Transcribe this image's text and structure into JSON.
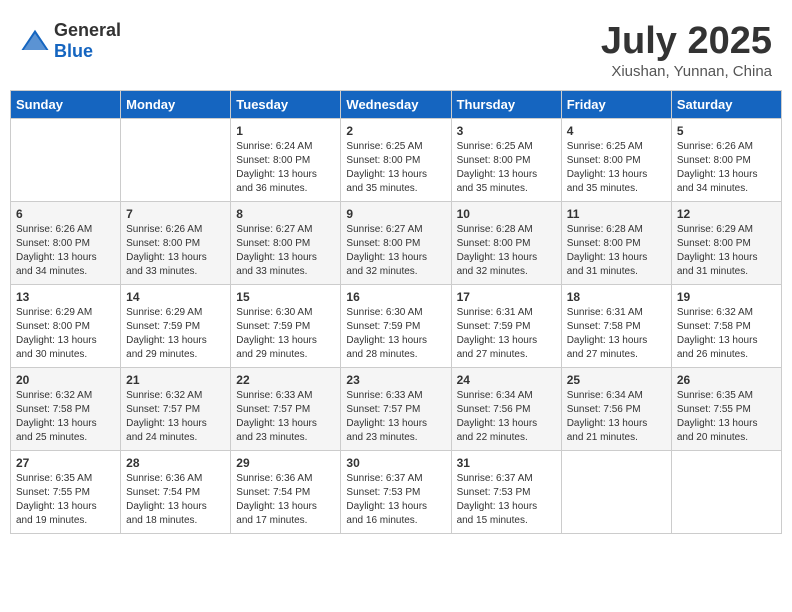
{
  "header": {
    "logo_general": "General",
    "logo_blue": "Blue",
    "month_title": "July 2025",
    "location": "Xiushan, Yunnan, China"
  },
  "weekdays": [
    "Sunday",
    "Monday",
    "Tuesday",
    "Wednesday",
    "Thursday",
    "Friday",
    "Saturday"
  ],
  "weeks": [
    [
      {
        "day": "",
        "info": ""
      },
      {
        "day": "",
        "info": ""
      },
      {
        "day": "1",
        "info": "Sunrise: 6:24 AM\nSunset: 8:00 PM\nDaylight: 13 hours and 36 minutes."
      },
      {
        "day": "2",
        "info": "Sunrise: 6:25 AM\nSunset: 8:00 PM\nDaylight: 13 hours and 35 minutes."
      },
      {
        "day": "3",
        "info": "Sunrise: 6:25 AM\nSunset: 8:00 PM\nDaylight: 13 hours and 35 minutes."
      },
      {
        "day": "4",
        "info": "Sunrise: 6:25 AM\nSunset: 8:00 PM\nDaylight: 13 hours and 35 minutes."
      },
      {
        "day": "5",
        "info": "Sunrise: 6:26 AM\nSunset: 8:00 PM\nDaylight: 13 hours and 34 minutes."
      }
    ],
    [
      {
        "day": "6",
        "info": "Sunrise: 6:26 AM\nSunset: 8:00 PM\nDaylight: 13 hours and 34 minutes."
      },
      {
        "day": "7",
        "info": "Sunrise: 6:26 AM\nSunset: 8:00 PM\nDaylight: 13 hours and 33 minutes."
      },
      {
        "day": "8",
        "info": "Sunrise: 6:27 AM\nSunset: 8:00 PM\nDaylight: 13 hours and 33 minutes."
      },
      {
        "day": "9",
        "info": "Sunrise: 6:27 AM\nSunset: 8:00 PM\nDaylight: 13 hours and 32 minutes."
      },
      {
        "day": "10",
        "info": "Sunrise: 6:28 AM\nSunset: 8:00 PM\nDaylight: 13 hours and 32 minutes."
      },
      {
        "day": "11",
        "info": "Sunrise: 6:28 AM\nSunset: 8:00 PM\nDaylight: 13 hours and 31 minutes."
      },
      {
        "day": "12",
        "info": "Sunrise: 6:29 AM\nSunset: 8:00 PM\nDaylight: 13 hours and 31 minutes."
      }
    ],
    [
      {
        "day": "13",
        "info": "Sunrise: 6:29 AM\nSunset: 8:00 PM\nDaylight: 13 hours and 30 minutes."
      },
      {
        "day": "14",
        "info": "Sunrise: 6:29 AM\nSunset: 7:59 PM\nDaylight: 13 hours and 29 minutes."
      },
      {
        "day": "15",
        "info": "Sunrise: 6:30 AM\nSunset: 7:59 PM\nDaylight: 13 hours and 29 minutes."
      },
      {
        "day": "16",
        "info": "Sunrise: 6:30 AM\nSunset: 7:59 PM\nDaylight: 13 hours and 28 minutes."
      },
      {
        "day": "17",
        "info": "Sunrise: 6:31 AM\nSunset: 7:59 PM\nDaylight: 13 hours and 27 minutes."
      },
      {
        "day": "18",
        "info": "Sunrise: 6:31 AM\nSunset: 7:58 PM\nDaylight: 13 hours and 27 minutes."
      },
      {
        "day": "19",
        "info": "Sunrise: 6:32 AM\nSunset: 7:58 PM\nDaylight: 13 hours and 26 minutes."
      }
    ],
    [
      {
        "day": "20",
        "info": "Sunrise: 6:32 AM\nSunset: 7:58 PM\nDaylight: 13 hours and 25 minutes."
      },
      {
        "day": "21",
        "info": "Sunrise: 6:32 AM\nSunset: 7:57 PM\nDaylight: 13 hours and 24 minutes."
      },
      {
        "day": "22",
        "info": "Sunrise: 6:33 AM\nSunset: 7:57 PM\nDaylight: 13 hours and 23 minutes."
      },
      {
        "day": "23",
        "info": "Sunrise: 6:33 AM\nSunset: 7:57 PM\nDaylight: 13 hours and 23 minutes."
      },
      {
        "day": "24",
        "info": "Sunrise: 6:34 AM\nSunset: 7:56 PM\nDaylight: 13 hours and 22 minutes."
      },
      {
        "day": "25",
        "info": "Sunrise: 6:34 AM\nSunset: 7:56 PM\nDaylight: 13 hours and 21 minutes."
      },
      {
        "day": "26",
        "info": "Sunrise: 6:35 AM\nSunset: 7:55 PM\nDaylight: 13 hours and 20 minutes."
      }
    ],
    [
      {
        "day": "27",
        "info": "Sunrise: 6:35 AM\nSunset: 7:55 PM\nDaylight: 13 hours and 19 minutes."
      },
      {
        "day": "28",
        "info": "Sunrise: 6:36 AM\nSunset: 7:54 PM\nDaylight: 13 hours and 18 minutes."
      },
      {
        "day": "29",
        "info": "Sunrise: 6:36 AM\nSunset: 7:54 PM\nDaylight: 13 hours and 17 minutes."
      },
      {
        "day": "30",
        "info": "Sunrise: 6:37 AM\nSunset: 7:53 PM\nDaylight: 13 hours and 16 minutes."
      },
      {
        "day": "31",
        "info": "Sunrise: 6:37 AM\nSunset: 7:53 PM\nDaylight: 13 hours and 15 minutes."
      },
      {
        "day": "",
        "info": ""
      },
      {
        "day": "",
        "info": ""
      }
    ]
  ]
}
